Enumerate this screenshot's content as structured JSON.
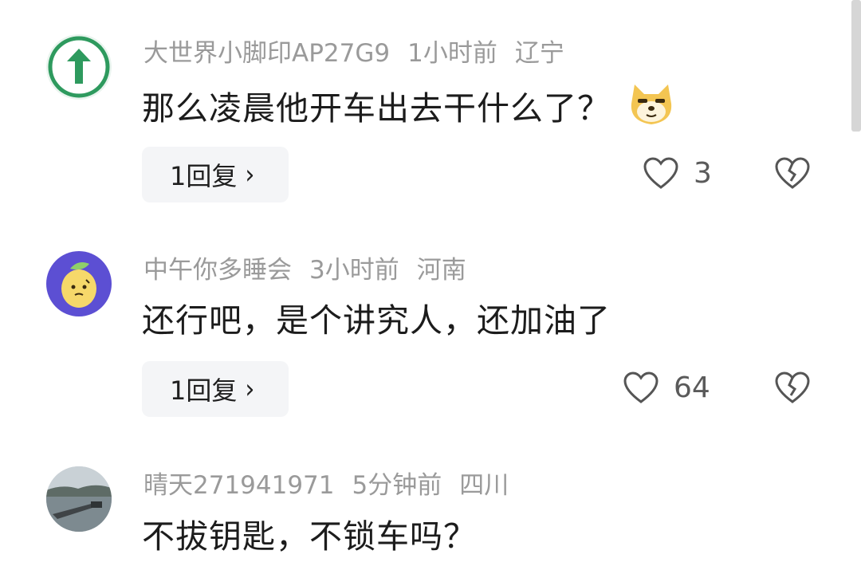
{
  "comments": [
    {
      "username": "大世界小脚印AP27G9",
      "time": "1小时前",
      "location": "辽宁",
      "text": "那么凌晨他开车出去干什么了？",
      "emoji": "doge-emoji",
      "reply_count": "1回复",
      "likes": "3",
      "avatar": "green-up-arrow-avatar"
    },
    {
      "username": "中午你多睡会",
      "time": "3小时前",
      "location": "河南",
      "text": "还行吧，是个讲究人，还加油了",
      "reply_count": "1回复",
      "likes": "64",
      "avatar": "lemon-avatar"
    },
    {
      "username": "晴天271941971",
      "time": "5分钟前",
      "location": "四川",
      "text": "不拔钥匙，不锁车吗？",
      "avatar": "lake-photo-avatar"
    }
  ],
  "icons": {
    "like": "heart-outline-icon",
    "dislike": "broken-heart-icon",
    "reply_chevron": "chevron-right-icon"
  },
  "colors": {
    "meta_text": "#9a9a9a",
    "reply_bg": "#f4f5f7",
    "avatar_green": "#2e9a5e",
    "avatar_purple": "#5c4fd3",
    "lemon": "#f6d86a"
  }
}
